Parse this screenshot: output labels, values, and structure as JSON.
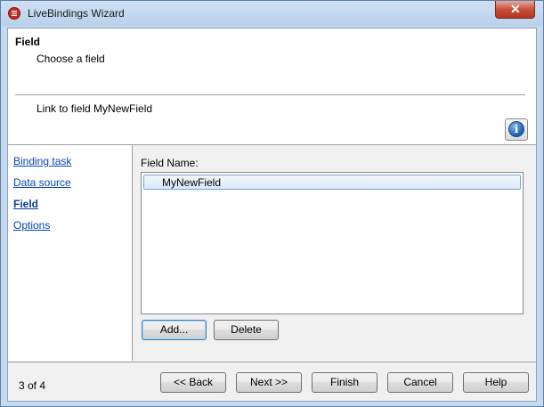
{
  "window": {
    "title": "LiveBindings Wizard",
    "close_label": "✕"
  },
  "header": {
    "title": "Field",
    "subtitle": "Choose a field",
    "link_text": "Link to field MyNewField",
    "info_icon": "i"
  },
  "sidebar": {
    "items": [
      {
        "label": "Binding task",
        "active": false
      },
      {
        "label": "Data source",
        "active": false
      },
      {
        "label": "Field",
        "active": true
      },
      {
        "label": "Options",
        "active": false
      }
    ]
  },
  "main": {
    "field_name_label": "Field Name:",
    "fields": [
      "MyNewField"
    ],
    "selected_field": "MyNewField",
    "add_label": "Add...",
    "delete_label": "Delete"
  },
  "footer": {
    "page_count": "3 of 4",
    "back_label": "<< Back",
    "next_label": "Next >>",
    "finish_label": "Finish",
    "cancel_label": "Cancel",
    "help_label": "Help"
  },
  "colors": {
    "link": "#0645ad",
    "selection": "#dbe9fb",
    "close_red": "#c7503c"
  }
}
